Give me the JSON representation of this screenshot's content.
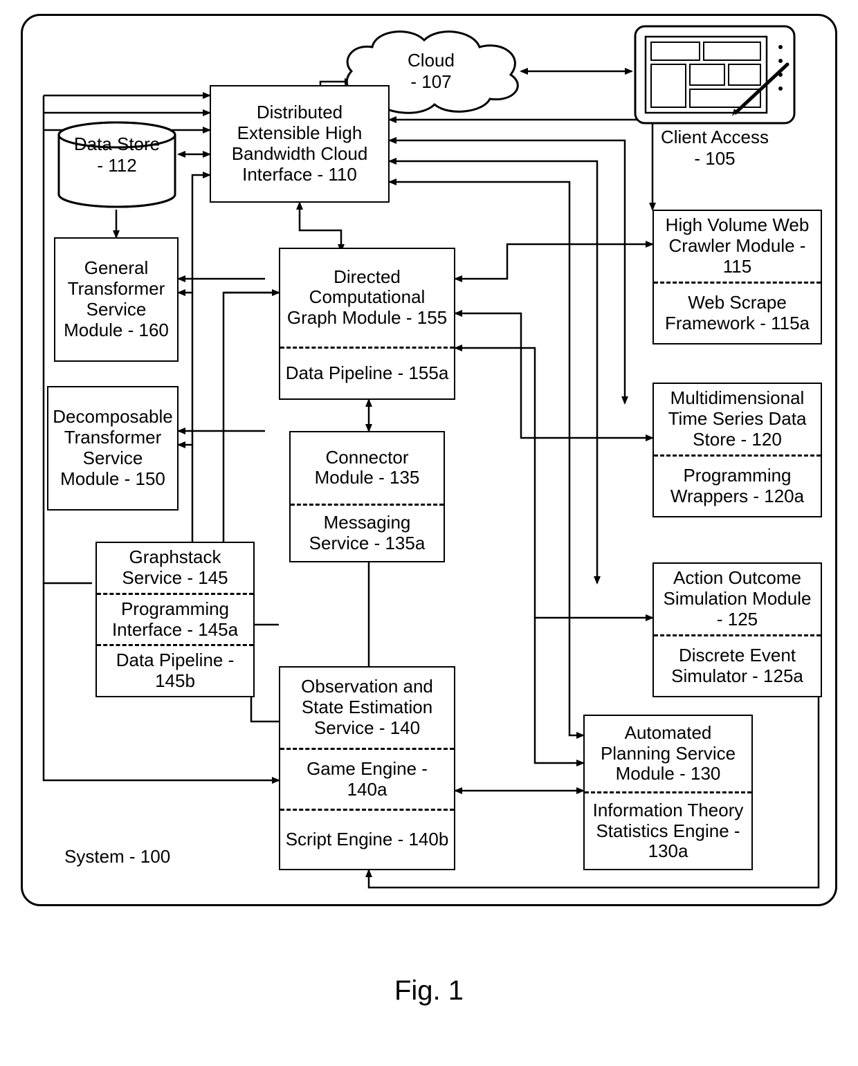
{
  "figure_caption": "Fig. 1",
  "system_label": "System - 100",
  "cloud": {
    "line1": "Cloud",
    "line2": "- 107"
  },
  "client_access": {
    "line1": "Client Access",
    "line2": "- 105"
  },
  "data_store": {
    "line1": "Data Store",
    "line2": "- 112"
  },
  "n110": {
    "text": "Distributed Extensible High Bandwidth Cloud Interface - 110"
  },
  "n160": {
    "text": "General Transformer Service Module - 160"
  },
  "n150": {
    "text": "Decomposable Transformer Service Module - 150"
  },
  "n145": {
    "a": "Graphstack Service - 145",
    "b": "Programming Interface - 145a",
    "c": "Data Pipeline - 145b"
  },
  "n155": {
    "a": "Directed Computational Graph Module - 155",
    "b": "Data Pipeline - 155a"
  },
  "n135": {
    "a": "Connector Module - 135",
    "b": "Messaging Service - 135a"
  },
  "n140": {
    "a": "Observation and State Estimation Service - 140",
    "b": "Game Engine - 140a",
    "c": "Script Engine - 140b"
  },
  "n115": {
    "a": "High Volume Web Crawler Module - 115",
    "b": "Web Scrape Framework - 115a"
  },
  "n120": {
    "a": "Multidimensional Time Series Data Store - 120",
    "b": "Programming Wrappers - 120a"
  },
  "n125": {
    "a": "Action Outcome Simulation Module - 125",
    "b": "Discrete Event Simulator - 125a"
  },
  "n130": {
    "a": "Automated Planning Service Module - 130",
    "b": "Information Theory Statistics Engine - 130a"
  }
}
